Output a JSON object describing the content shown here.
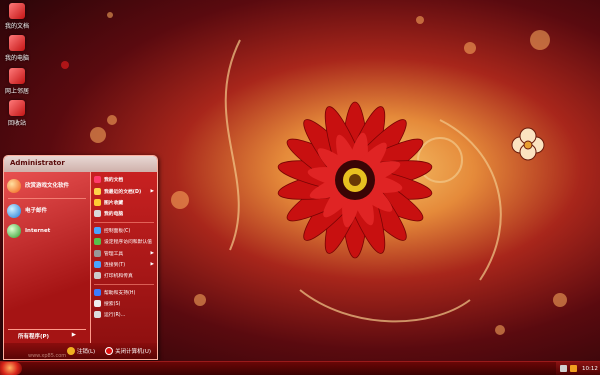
{
  "desktop_icons": [
    {
      "label": "我的文档"
    },
    {
      "label": "我的电脑"
    },
    {
      "label": "网上邻居"
    },
    {
      "label": "回收站"
    }
  ],
  "start_menu": {
    "user_name": "Administrator",
    "pinned": [
      {
        "title": "欣赏游戏文化软件",
        "subtitle": ""
      },
      {
        "title": "电子邮件",
        "subtitle": ""
      },
      {
        "title": "Internet",
        "subtitle": ""
      }
    ],
    "all_programs_label": "所有程序(P)",
    "right_items": [
      {
        "label": "我的文档",
        "arrow": "",
        "bold": true,
        "color": "#ff3b6b"
      },
      {
        "label": "我最近的文档(D)",
        "arrow": "▶",
        "bold": true,
        "color": "#ffd24a"
      },
      {
        "label": "图片收藏",
        "arrow": "",
        "bold": true,
        "color": "#ffcc33"
      },
      {
        "label": "我的电脑",
        "arrow": "",
        "bold": true,
        "color": "#d9d9d9"
      },
      {
        "label": "控制面板(C)",
        "arrow": "",
        "bold": false,
        "color": "#4aa3ff"
      },
      {
        "label": "设定程序访问和默认值",
        "arrow": "",
        "bold": false,
        "color": "#57c24a"
      },
      {
        "label": "管理工具",
        "arrow": "▶",
        "bold": false,
        "color": "#999999"
      },
      {
        "label": "连接到(T)",
        "arrow": "▶",
        "bold": false,
        "color": "#4aa3ff"
      },
      {
        "label": "打印机和传真",
        "arrow": "",
        "bold": false,
        "color": "#cccccc"
      },
      {
        "label": "帮助和支持(H)",
        "arrow": "",
        "bold": false,
        "color": "#3b7bff"
      },
      {
        "label": "搜索(S)",
        "arrow": "",
        "bold": false,
        "color": "#eeeeee"
      },
      {
        "label": "运行(R)...",
        "arrow": "",
        "bold": false,
        "color": "#dddddd"
      }
    ],
    "footer": {
      "logoff_label": "注销(L)",
      "shutdown_label": "关闭计算机(U)"
    }
  },
  "taskbar": {
    "clock": "10:12"
  },
  "watermark": "www.xp85.com"
}
